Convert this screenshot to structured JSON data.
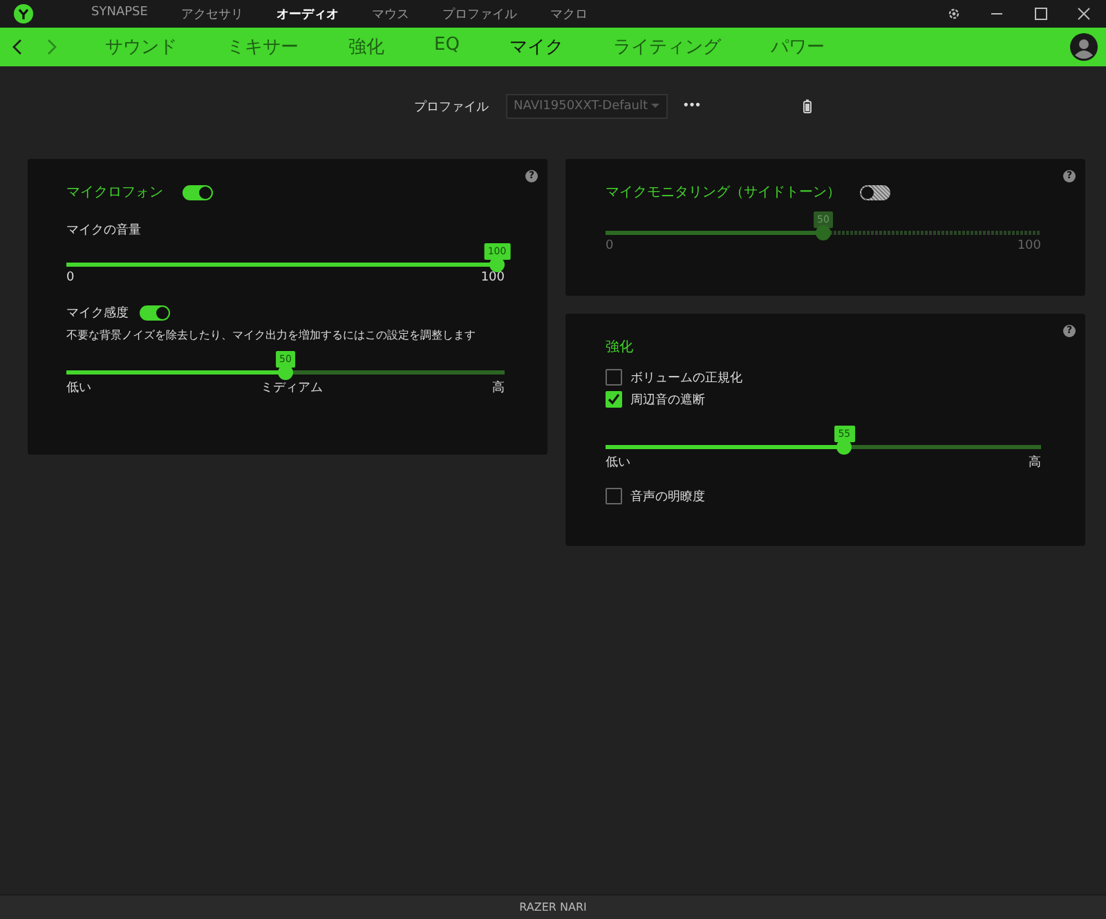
{
  "top_nav": [
    {
      "label": "SYNAPSE",
      "selected": false
    },
    {
      "label": "アクセサリ",
      "selected": false
    },
    {
      "label": "オーディオ",
      "selected": true
    },
    {
      "label": "マウス",
      "selected": false
    },
    {
      "label": "プロファイル",
      "selected": false
    },
    {
      "label": "マクロ",
      "selected": false
    }
  ],
  "sub_nav": [
    {
      "label": "サウンド",
      "selected": false
    },
    {
      "label": "ミキサー",
      "selected": false
    },
    {
      "label": "強化",
      "selected": false
    },
    {
      "label": "EQ",
      "selected": false
    },
    {
      "label": "マイク",
      "selected": true
    },
    {
      "label": "ライティング",
      "selected": false
    },
    {
      "label": "パワー",
      "selected": false
    }
  ],
  "profile": {
    "label": "プロファイル",
    "value": "NAVI1950XXT-Default",
    "more": "•••"
  },
  "microphone_card": {
    "title": "マイクロフォン",
    "on": true,
    "help": "?",
    "volume": {
      "label": "マイクの音量",
      "value": "100",
      "level": 1,
      "scale_labels": [
        "0",
        "100"
      ]
    },
    "sensitivity": {
      "label": "マイク感度",
      "on": true,
      "description": "不要な背景ノイズを除去したり、マイク出力を増加するにはこの設定を調整します",
      "value": "50",
      "level": 0.5,
      "scale_labels": [
        "低い",
        "ミディアム",
        "高"
      ]
    }
  },
  "monitoring_card": {
    "title": "マイクモニタリング（サイドトーン）",
    "on": false,
    "help": "?",
    "value": "50",
    "level": 0.5,
    "scale_labels": [
      "0",
      "100"
    ]
  },
  "enhancement_card": {
    "title": "強化",
    "help": "?",
    "items": [
      {
        "kind": "checkbox",
        "label": "ボリュームの正規化",
        "checked": false
      },
      {
        "kind": "checkbox",
        "label": "周辺音の遮断",
        "checked": true
      },
      {
        "kind": "slider",
        "value": "55",
        "level": 0.55,
        "scale_labels": [
          "低い",
          "高"
        ]
      },
      {
        "kind": "checkbox",
        "label": "音声の明瞭度",
        "checked": false
      }
    ]
  },
  "status_bar": {
    "device": "RAZER NARI"
  }
}
